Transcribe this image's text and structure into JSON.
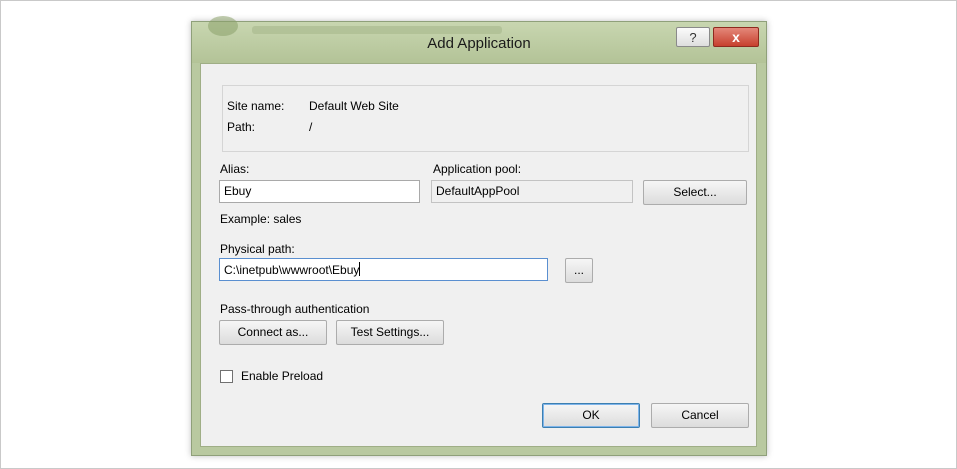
{
  "dialog": {
    "title": "Add Application",
    "help_glyph": "?",
    "close_glyph": "x"
  },
  "site_info": {
    "site_name_label": "Site name:",
    "site_name_value": "Default Web Site",
    "path_label": "Path:",
    "path_value": "/"
  },
  "alias": {
    "label": "Alias:",
    "value": "Ebuy",
    "example": "Example: sales"
  },
  "app_pool": {
    "label": "Application pool:",
    "value": "DefaultAppPool",
    "select_label": "Select..."
  },
  "physical_path": {
    "label": "Physical path:",
    "value": "C:\\inetpub\\wwwroot\\Ebuy",
    "browse_label": "..."
  },
  "auth": {
    "label": "Pass-through authentication",
    "connect_label": "Connect as...",
    "test_label": "Test Settings..."
  },
  "preload": {
    "label": "Enable Preload",
    "checked": false
  },
  "footer": {
    "ok_label": "OK",
    "cancel_label": "Cancel"
  },
  "colors": {
    "titlebar": "#b9c9a0",
    "close_button": "#c7402e",
    "client_bg": "#f0f0f0"
  }
}
